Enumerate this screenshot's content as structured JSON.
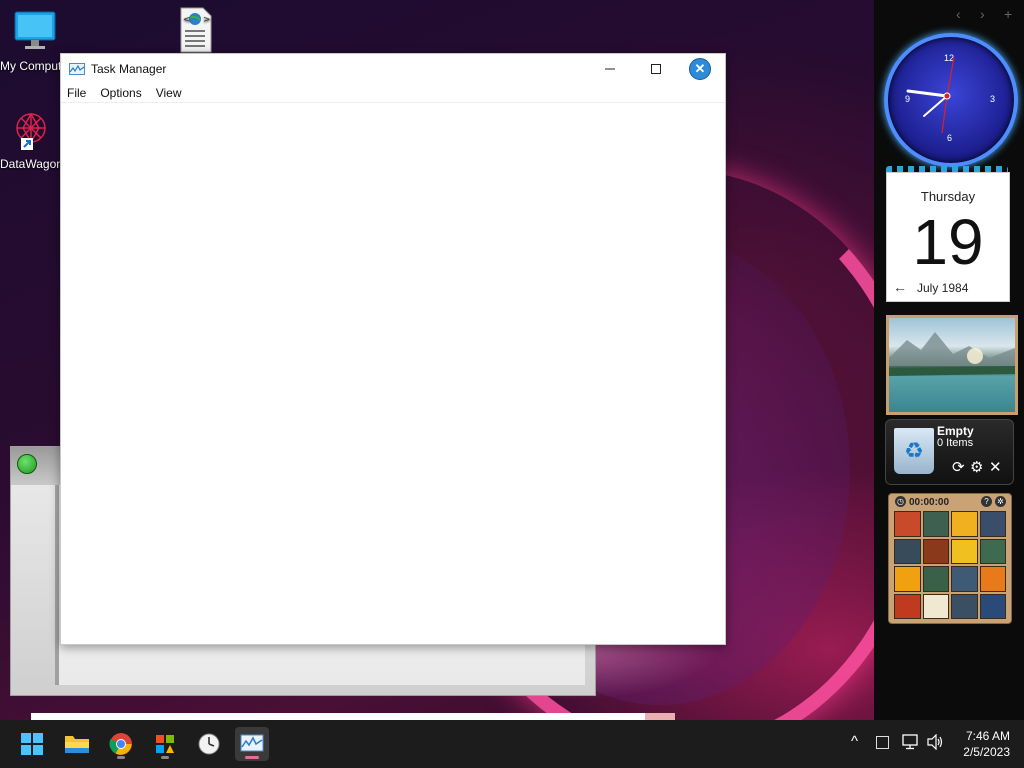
{
  "desktop": {
    "icons": [
      {
        "label": "My Computer",
        "icon": "monitor-icon"
      },
      {
        "label": "DataWagon",
        "icon": "datawagon-shortcut-icon"
      },
      {
        "label": "",
        "icon": "html-document-icon"
      }
    ]
  },
  "task_manager": {
    "title": "Task Manager",
    "menu": [
      "File",
      "Options",
      "View"
    ],
    "controls": {
      "minimize": "—",
      "maximize": "☐",
      "close": "✕"
    }
  },
  "gadgets": {
    "nav": [
      "‹",
      "›",
      "+"
    ],
    "clock": {
      "numbers": [
        "12",
        "3",
        "6",
        "9"
      ],
      "time": "7:46"
    },
    "calendar": {
      "weekday": "Thursday",
      "day": "19",
      "month_year": "July 1984",
      "back_arrow": "←"
    },
    "photo": {
      "subject": "mountain-lake-landscape"
    },
    "recycle_bin": {
      "title": "Empty",
      "count": "0 Items",
      "refresh": "⟳",
      "settings": "⚙",
      "close": "✕"
    },
    "puzzle": {
      "timer": "00:00:00",
      "help": "?",
      "clock_btn": "◷"
    }
  },
  "taskbar": {
    "apps": [
      {
        "name": "start-button",
        "icon": "windows-logo-icon"
      },
      {
        "name": "file-explorer",
        "icon": "folder-icon"
      },
      {
        "name": "chrome",
        "icon": "chrome-icon"
      },
      {
        "name": "store-app",
        "icon": "store-icon"
      },
      {
        "name": "clock-app",
        "icon": "clock-icon"
      },
      {
        "name": "task-manager",
        "icon": "task-manager-icon",
        "active": true
      }
    ],
    "tray": {
      "chevron": "^",
      "time": "7:46 AM",
      "date": "2/5/2023"
    }
  }
}
